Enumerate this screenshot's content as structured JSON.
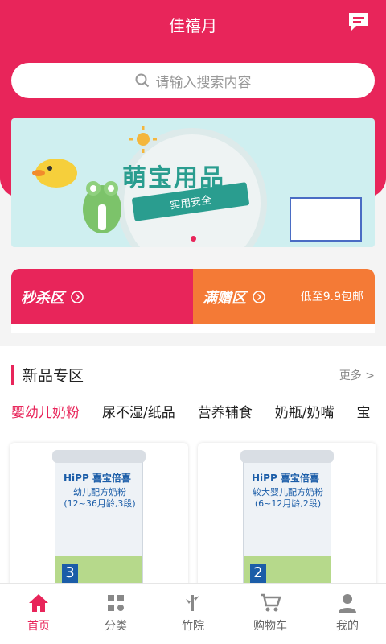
{
  "header": {
    "title": "佳禧月"
  },
  "search": {
    "placeholder": "请输入搜索内容"
  },
  "banner": {
    "title": "萌宝用品",
    "subtitle": "实用安全"
  },
  "promo": {
    "left": {
      "label": "秒杀区"
    },
    "right": {
      "label": "满赠区",
      "note": "低至9.9包邮"
    }
  },
  "section": {
    "title": "新品专区",
    "more": "更多 >",
    "tabs": [
      "婴幼儿奶粉",
      "尿不湿/纸品",
      "营养辅食",
      "奶瓶/奶嘴",
      "宝"
    ]
  },
  "products": [
    {
      "brand": "HiPP 喜宝倍喜",
      "label": "幼儿配方奶粉 (12~36月龄,3段)",
      "stage": "3"
    },
    {
      "brand": "HiPP 喜宝倍喜",
      "label": "较大婴儿配方奶粉 (6~12月龄,2段)",
      "stage": "2"
    }
  ],
  "nav": [
    "首页",
    "分类",
    "竹院",
    "购物车",
    "我的"
  ],
  "colors": {
    "accent": "#e8255a",
    "orange": "#f47a36"
  }
}
